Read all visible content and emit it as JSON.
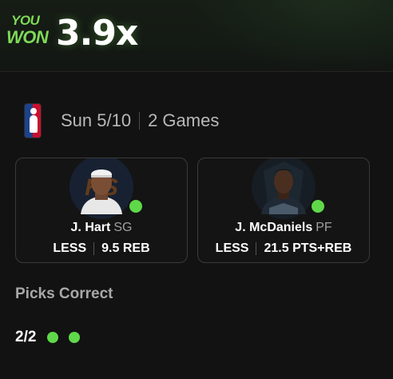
{
  "result": {
    "line1": "YOU",
    "line2": "WON",
    "multiplier": "3.9x"
  },
  "league": {
    "icon": "nba-logo",
    "date": "Sun 5/10",
    "games": "2 Games"
  },
  "picks": [
    {
      "name": "J. Hart",
      "position": "SG",
      "direction": "LESS",
      "line": "9.5",
      "stat": "REB",
      "team_colors": [
        "#f58426",
        "#006bb6"
      ],
      "result_color": "#5fd94a"
    },
    {
      "name": "J. McDaniels",
      "position": "PF",
      "direction": "LESS",
      "line": "21.5",
      "stat": "PTS+REB",
      "team_colors": [
        "#236192",
        "#9ea2a2"
      ],
      "result_color": "#5fd94a"
    }
  ],
  "summary": {
    "title": "Picks Correct",
    "count": "2/2",
    "dots": 2
  },
  "colors": {
    "accent": "#7ed957",
    "win_dot": "#5fd94a",
    "background": "#121212"
  }
}
